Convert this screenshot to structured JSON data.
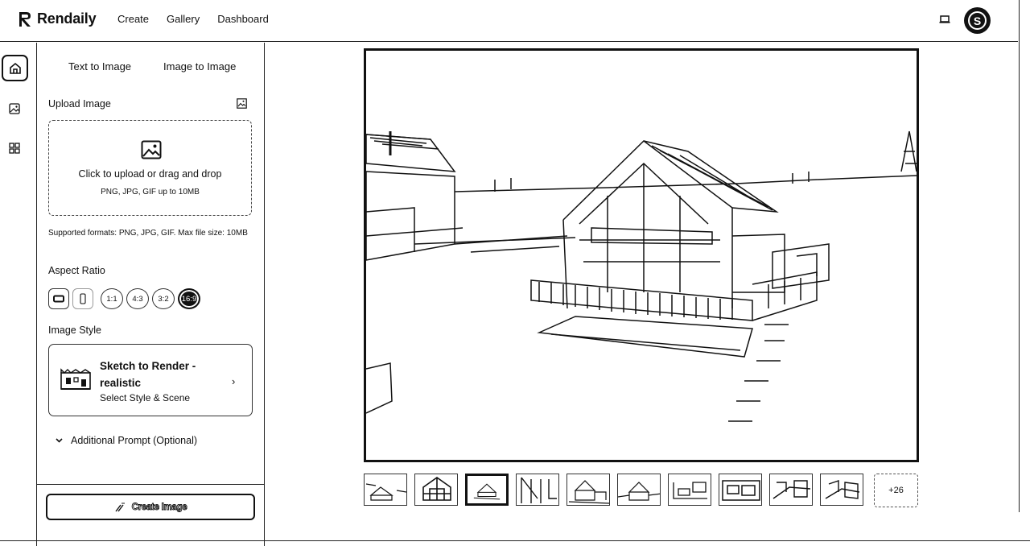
{
  "app": {
    "name": "Rendaily"
  },
  "nav": {
    "items": [
      "Create",
      "Gallery",
      "Dashboard"
    ]
  },
  "user": {
    "avatar_letter": "S"
  },
  "sidebar": {
    "icons": [
      "home-icon",
      "image-icon",
      "apps-icon"
    ]
  },
  "panel": {
    "tabs": [
      "Text to Image",
      "Image to Image"
    ],
    "upload": {
      "label": "Upload Image",
      "title": "Click to upload or drag and drop",
      "subtitle": "PNG, JPG, GIF up to 10MB",
      "formats_note": "Supported formats: PNG, JPG, GIF. Max file size: 10MB"
    },
    "aspect": {
      "label": "Aspect Ratio",
      "options": [
        "landscape",
        "portrait",
        "1:1",
        "4:3",
        "3:2",
        "16:9"
      ],
      "selected": "16:9"
    },
    "style": {
      "label": "Image Style",
      "title": "Sketch to Render - realistic",
      "subtitle": "Select Style & Scene"
    },
    "additional_prompt": "Additional Prompt (Optional)",
    "create_button": "Create Image"
  },
  "gallery": {
    "thumbnail_count": 10,
    "selected_index": 2,
    "more_label": "+26"
  }
}
